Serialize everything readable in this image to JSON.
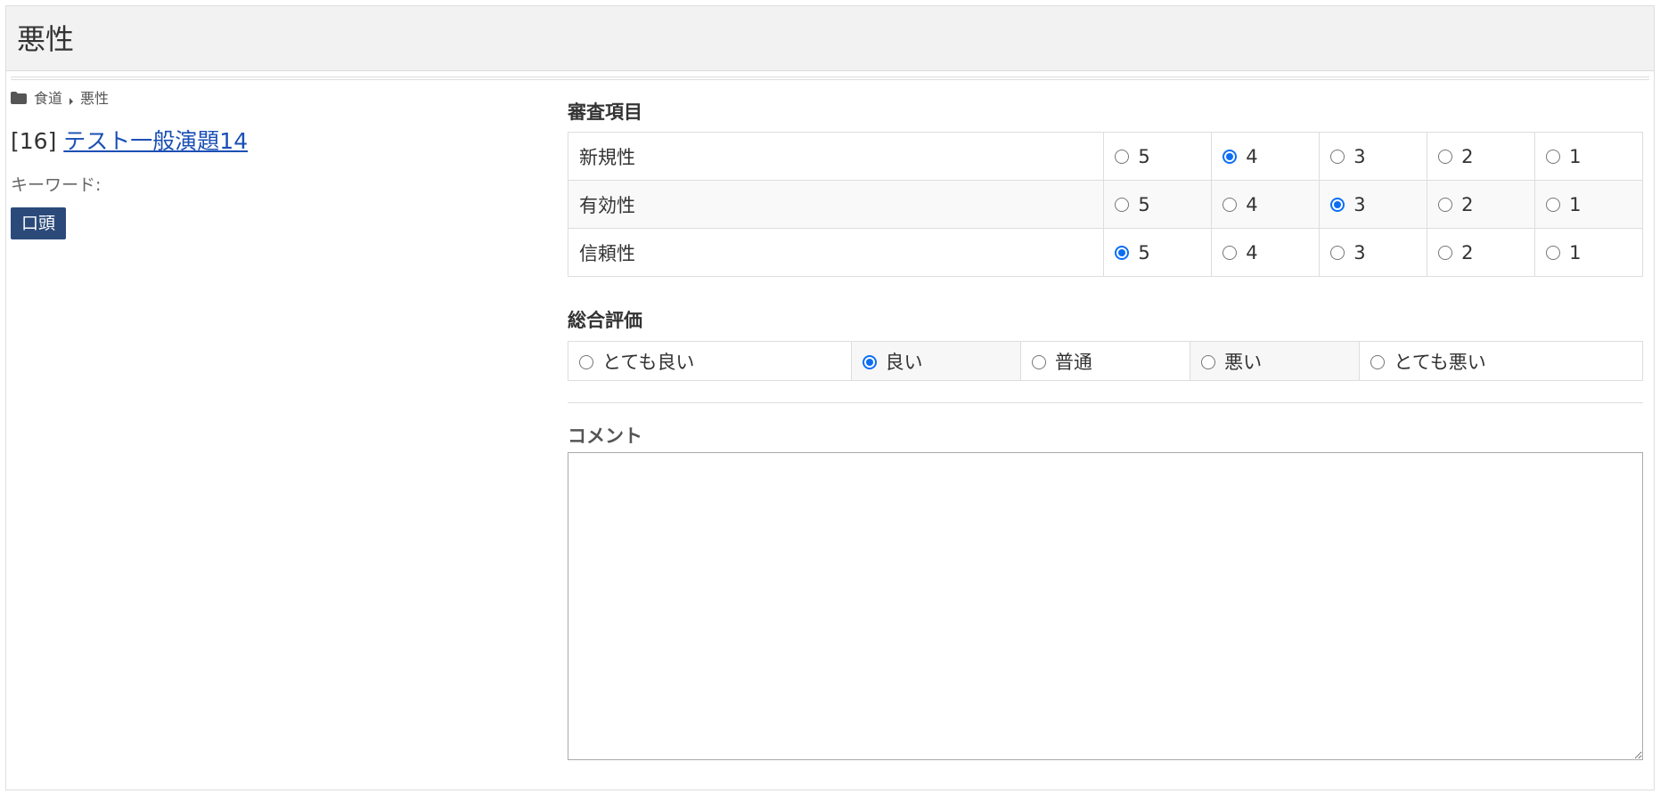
{
  "header": {
    "title": "悪性"
  },
  "breadcrumb": {
    "category": "食道",
    "current": "悪性"
  },
  "paper": {
    "number": "[16]",
    "title": "テスト一般演題14"
  },
  "keywords": {
    "label": "キーワード:"
  },
  "presentation_type": "口頭",
  "review": {
    "heading": "審査項目",
    "criteria": [
      {
        "label": "新規性",
        "options": [
          "5",
          "4",
          "3",
          "2",
          "1"
        ],
        "selected": "4"
      },
      {
        "label": "有効性",
        "options": [
          "5",
          "4",
          "3",
          "2",
          "1"
        ],
        "selected": "3"
      },
      {
        "label": "信頼性",
        "options": [
          "5",
          "4",
          "3",
          "2",
          "1"
        ],
        "selected": "5"
      }
    ]
  },
  "overall": {
    "heading": "総合評価",
    "options": [
      "とても良い",
      "良い",
      "普通",
      "悪い",
      "とても悪い"
    ],
    "selected": "良い"
  },
  "comment": {
    "label": "コメント",
    "value": ""
  },
  "colors": {
    "accent": "#0b6ff5",
    "badge": "#2b4a7a",
    "link": "#1a4fb4"
  },
  "icons": {
    "breadcrumb_root": "folder-icon",
    "breadcrumb_separator": "caret-right-icon"
  }
}
